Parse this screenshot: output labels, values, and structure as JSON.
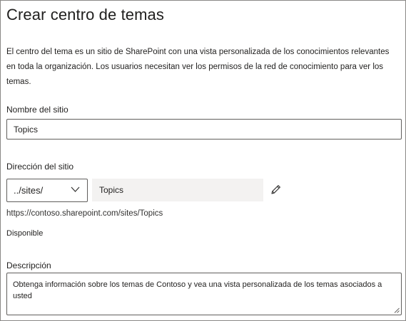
{
  "page": {
    "title": "Crear centro de temas",
    "description": "El centro del tema es un sitio de SharePoint con una vista personalizada de los conocimientos relevantes en toda la organización. Los usuarios necesitan ver los permisos de la red de conocimiento para ver los temas."
  },
  "site_name": {
    "label": "Nombre del sitio",
    "value": "Topics"
  },
  "site_address": {
    "label": "Dirección del sitio",
    "path_option": "../sites/",
    "value": "Topics",
    "full_url": "https://contoso.sharepoint.com/sites/Topics",
    "availability": "Disponible"
  },
  "description_field": {
    "label": "Descripción",
    "value": "Obtenga información sobre los temas de Contoso y vea una vista personalizada de los temas asociados a usted"
  },
  "icons": {
    "dropdown": "chevron-down-icon",
    "edit": "pencil-icon",
    "resize": "resize-grip-icon"
  },
  "colors": {
    "border": "#605e5c",
    "disabled_background": "#f3f2f1",
    "text": "#201f1e"
  }
}
